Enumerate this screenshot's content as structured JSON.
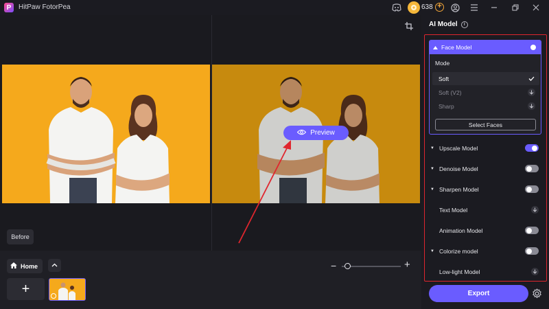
{
  "app": {
    "title": "HitPaw FotorPea",
    "logo_letter": "P"
  },
  "titlebar": {
    "coins": "638",
    "add_coins": "+"
  },
  "canvas": {
    "preview_label": "Preview",
    "before_label": "Before"
  },
  "tray": {
    "home_label": "Home",
    "add_label": "+",
    "zoom_minus": "−",
    "zoom_plus": "+",
    "zoom_level": 0.05
  },
  "panel": {
    "title": "AI Model",
    "info": "i",
    "face_model": {
      "label": "Face Model",
      "enabled": true,
      "mode_label": "Mode",
      "modes": [
        {
          "label": "Soft",
          "state": "selected"
        },
        {
          "label": "Soft (V2)",
          "state": "download"
        },
        {
          "label": "Sharp",
          "state": "download"
        }
      ],
      "select_faces_label": "Select Faces"
    },
    "models": [
      {
        "label": "Upscale Model",
        "caret": true,
        "control": "toggle",
        "enabled": true
      },
      {
        "label": "Denoise Model",
        "caret": true,
        "control": "toggle",
        "enabled": false
      },
      {
        "label": "Sharpen Model",
        "caret": true,
        "control": "toggle",
        "enabled": false
      },
      {
        "label": "Text Model",
        "caret": false,
        "control": "download",
        "enabled": false
      },
      {
        "label": "Animation Model",
        "caret": false,
        "control": "toggle",
        "enabled": false
      },
      {
        "label": "Colorize model",
        "caret": true,
        "control": "toggle",
        "enabled": false
      },
      {
        "label": "Low-light Model",
        "caret": false,
        "control": "download",
        "enabled": false
      }
    ],
    "export_label": "Export"
  },
  "colors": {
    "accent": "#6a5cff",
    "highlight_box": "#e0262e",
    "photo_bg": "#f5a91c"
  }
}
